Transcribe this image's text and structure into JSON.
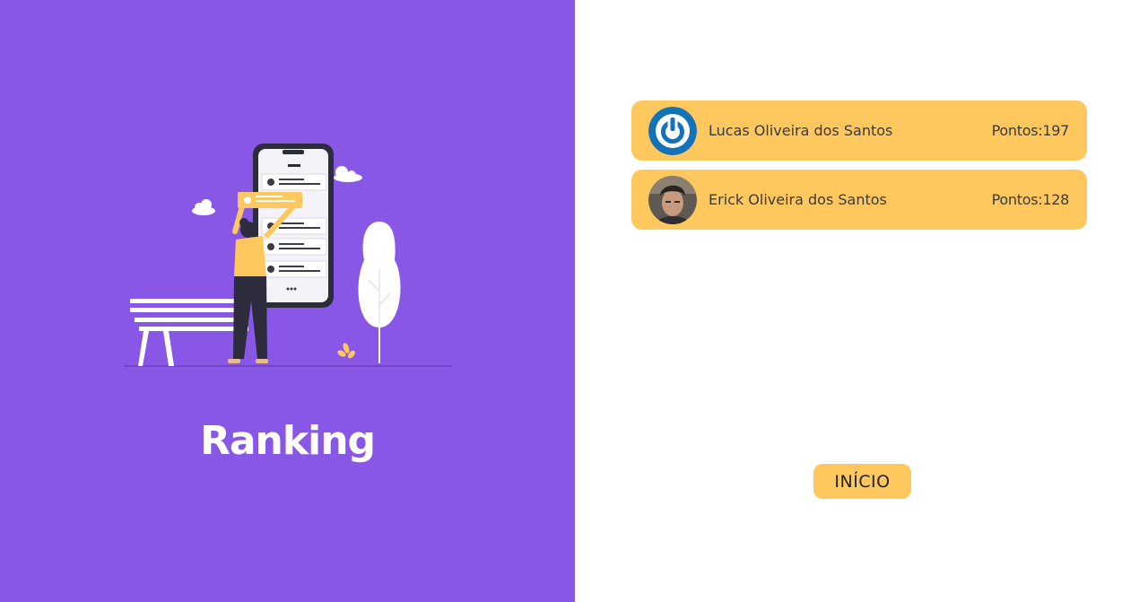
{
  "left": {
    "title": "Ranking",
    "illustration_name": "person-ranking-phone-illustration"
  },
  "ranking": {
    "entries": [
      {
        "name": "Lucas Oliveira dos Santos",
        "points": "Pontos:197",
        "avatar": "power-logo-avatar"
      },
      {
        "name": "Erick Oliveira dos Santos",
        "points": "Pontos:128",
        "avatar": "user-photo-avatar"
      }
    ]
  },
  "actions": {
    "home_label": "INÍCIO"
  },
  "colors": {
    "left_bg": "#8957e5",
    "accent": "#ffc85e",
    "text": "#3a3a3a"
  }
}
